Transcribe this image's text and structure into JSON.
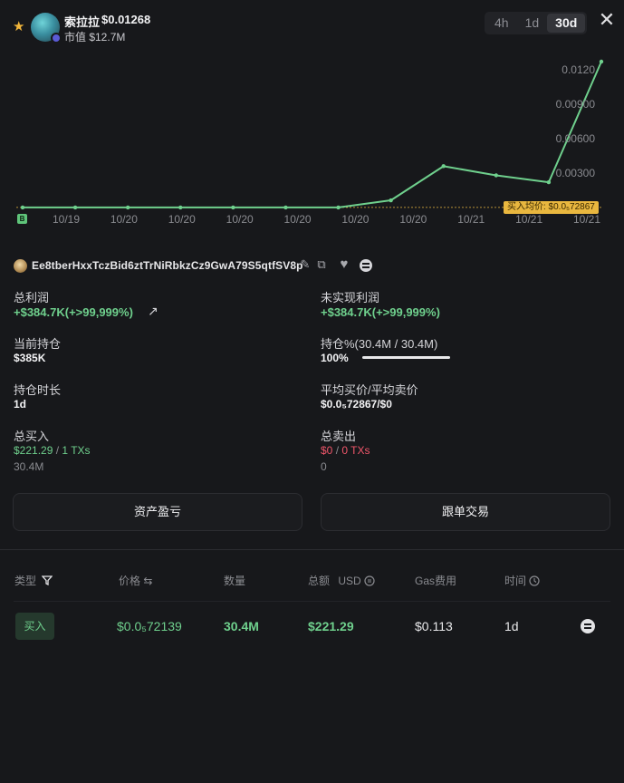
{
  "header": {
    "token_name": "索拉拉",
    "token_price": "$0.01268",
    "market_cap": "市值 $12.7M",
    "tabs": [
      {
        "label": "4h",
        "active": false
      },
      {
        "label": "1d",
        "active": false
      },
      {
        "label": "30d",
        "active": true
      }
    ],
    "close_glyph": "✕"
  },
  "chart_data": {
    "type": "line",
    "x": [
      "10/19",
      "10/20",
      "10/20",
      "10/20",
      "10/20",
      "10/20",
      "10/20",
      "10/21",
      "10/21",
      "10/21"
    ],
    "y": [
      7.3e-06,
      7.3e-06,
      7.3e-06,
      7.3e-06,
      7.3e-06,
      7.3e-06,
      7.3e-06,
      0.00063,
      0.0036,
      0.0028,
      0.0022,
      0.0127
    ],
    "x_tick_labels": [
      "10/19",
      "10/20",
      "10/20",
      "10/20",
      "10/20",
      "10/20",
      "10/20",
      "10/21",
      "10/21",
      "10/21"
    ],
    "y_tick_labels": [
      "0.0120",
      "0.00900",
      "0.00600",
      "0.00300"
    ],
    "y_ticks": [
      0.012,
      0.009,
      0.006,
      0.003
    ],
    "ylim": [
      0,
      0.0127
    ],
    "avg_buy_label": "买入均价: $0.0₅72867",
    "avg_buy_value": 7.2867e-06,
    "marker_label": "B",
    "line_color": "#6fd08d",
    "grid": false
  },
  "wallet": {
    "address": "Ee8tberHxxTczBid6ztTrNiRbkzCz9GwA79S5qtfSV8p",
    "edit_icon": "✎",
    "copy_icon": "⧉",
    "heart_icon": "♥"
  },
  "stats": {
    "total_profit_label": "总利润",
    "total_profit_value": "+$384.7K(+>99,999%)",
    "external_icon": "↗",
    "unrealized_label": "未实现利润",
    "unrealized_value": "+$384.7K(+>99,999%)",
    "holding_label": "当前持仓",
    "holding_value": "$385K",
    "position_pct_label": "持仓%(30.4M / 30.4M)",
    "position_pct_value": "100%",
    "position_fraction": 1.0,
    "duration_label": "持仓时长",
    "duration_value": "1d",
    "avg_price_label": "平均买价/平均卖价",
    "avg_price_value": "$0.0₅72867/$0",
    "total_buy_label": "总买入",
    "total_buy_amount": "$221.29",
    "total_buy_sep": " / ",
    "total_buy_txs": "1 TXs",
    "total_buy_qty": "30.4M",
    "total_sell_label": "总卖出",
    "total_sell_amount": "$0",
    "total_sell_sep": " / ",
    "total_sell_txs": "0 TXs",
    "total_sell_qty": "0"
  },
  "buttons": {
    "pnl": "资产盈亏",
    "copy_trade": "跟单交易"
  },
  "table": {
    "headers": {
      "type": "类型",
      "price": "价格",
      "price_icon": "⇆",
      "qty": "数量",
      "total": "总额",
      "usd": "USD",
      "gas": "Gas费用",
      "time": "时间"
    },
    "rows": [
      {
        "type": "买入",
        "price": "$0.0₅72139",
        "qty": "30.4M",
        "total": "$221.29",
        "gas": "$0.113",
        "time": "1d"
      }
    ]
  }
}
